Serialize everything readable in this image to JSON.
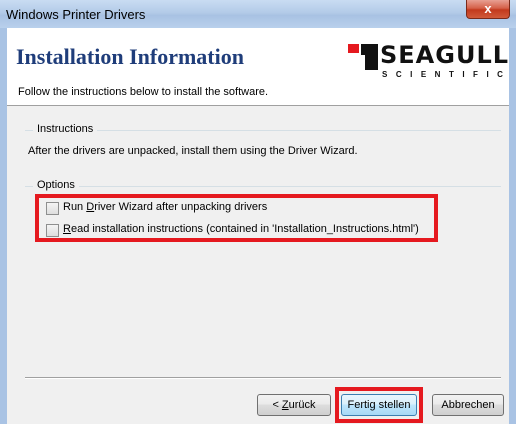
{
  "window": {
    "title": "Windows Printer Drivers",
    "close_glyph": "x"
  },
  "header": {
    "title": "Installation Information",
    "subtitle": "Follow the instructions below to install the software.",
    "logo": {
      "word": "SEAGULL",
      "sub": "SCIENTIFIC",
      "color": "#e5191f"
    }
  },
  "instructions": {
    "label": "Instructions",
    "text": "After the drivers are unpacked, install them using the Driver Wizard."
  },
  "options": {
    "label": "Options",
    "run_wizard": {
      "prefix": "Run ",
      "hotkey": "D",
      "suffix": "river Wizard after unpacking drivers",
      "checked": false
    },
    "read_instructions": {
      "prefix": "",
      "hotkey": "R",
      "suffix": "ead installation instructions (contained in 'Installation_Instructions.html')",
      "checked": false
    }
  },
  "buttons": {
    "back": {
      "prefix": "< ",
      "hotkey": "Z",
      "suffix": "urück"
    },
    "finish": {
      "label": "Fertig stellen"
    },
    "cancel": {
      "label": "Abbrechen"
    }
  },
  "highlight_color": "#e5191f"
}
